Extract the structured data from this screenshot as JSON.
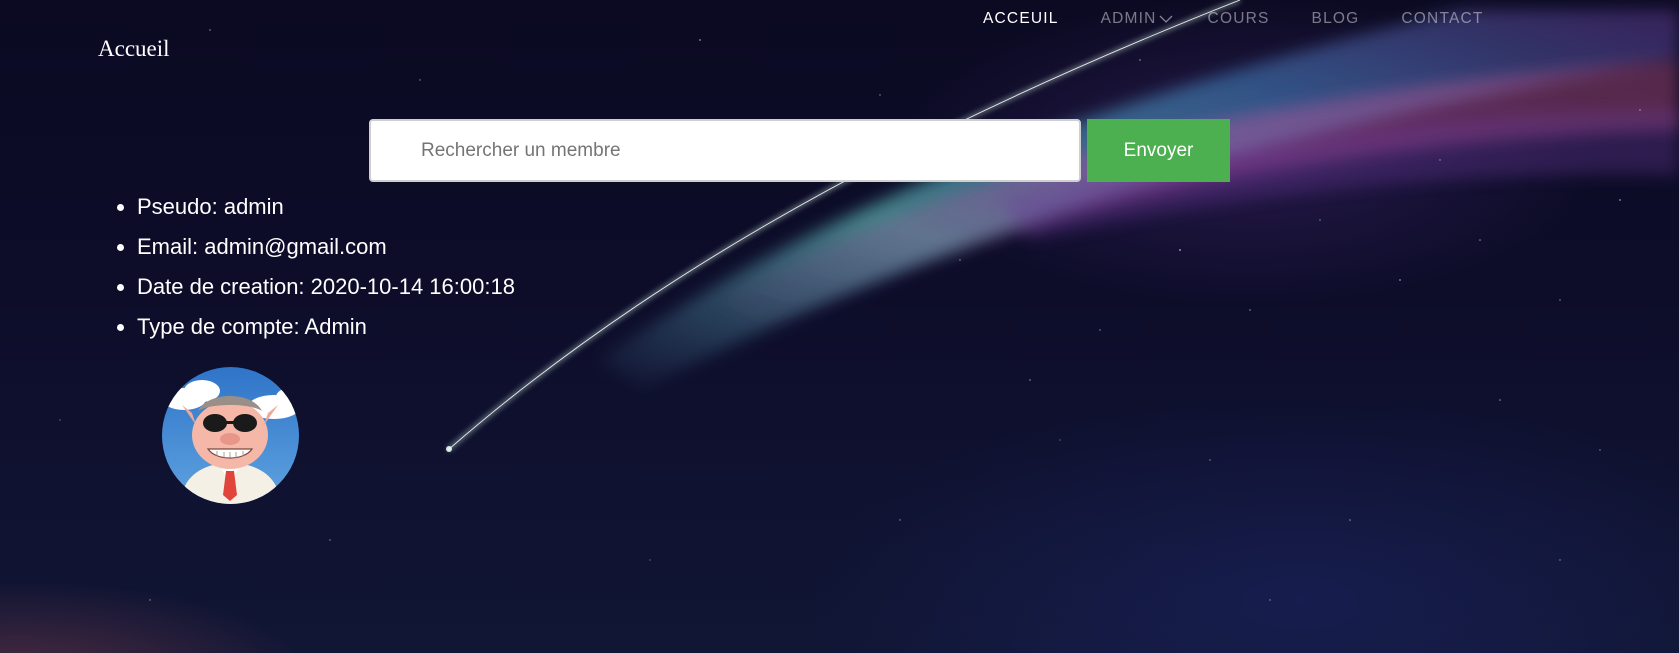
{
  "brand": "Accueil",
  "nav": {
    "items": [
      {
        "label": "ACCEUIL",
        "active": true
      },
      {
        "label": "ADMIN",
        "dropdown": true
      },
      {
        "label": "COURS"
      },
      {
        "label": "BLOG"
      },
      {
        "label": "CONTACT"
      }
    ]
  },
  "search": {
    "placeholder": "Rechercher un membre",
    "value": "",
    "button_label": "Envoyer"
  },
  "profile": {
    "pseudo": "Pseudo: admin",
    "email": "Email: admin@gmail.com",
    "created": "Date de creation: 2020-10-14 16:00:18",
    "account_type": "Type de compte: Admin",
    "avatar_icon": "avatar-pig-pilot"
  },
  "colors": {
    "button": "#4caf50",
    "background": "#0b0a22"
  }
}
